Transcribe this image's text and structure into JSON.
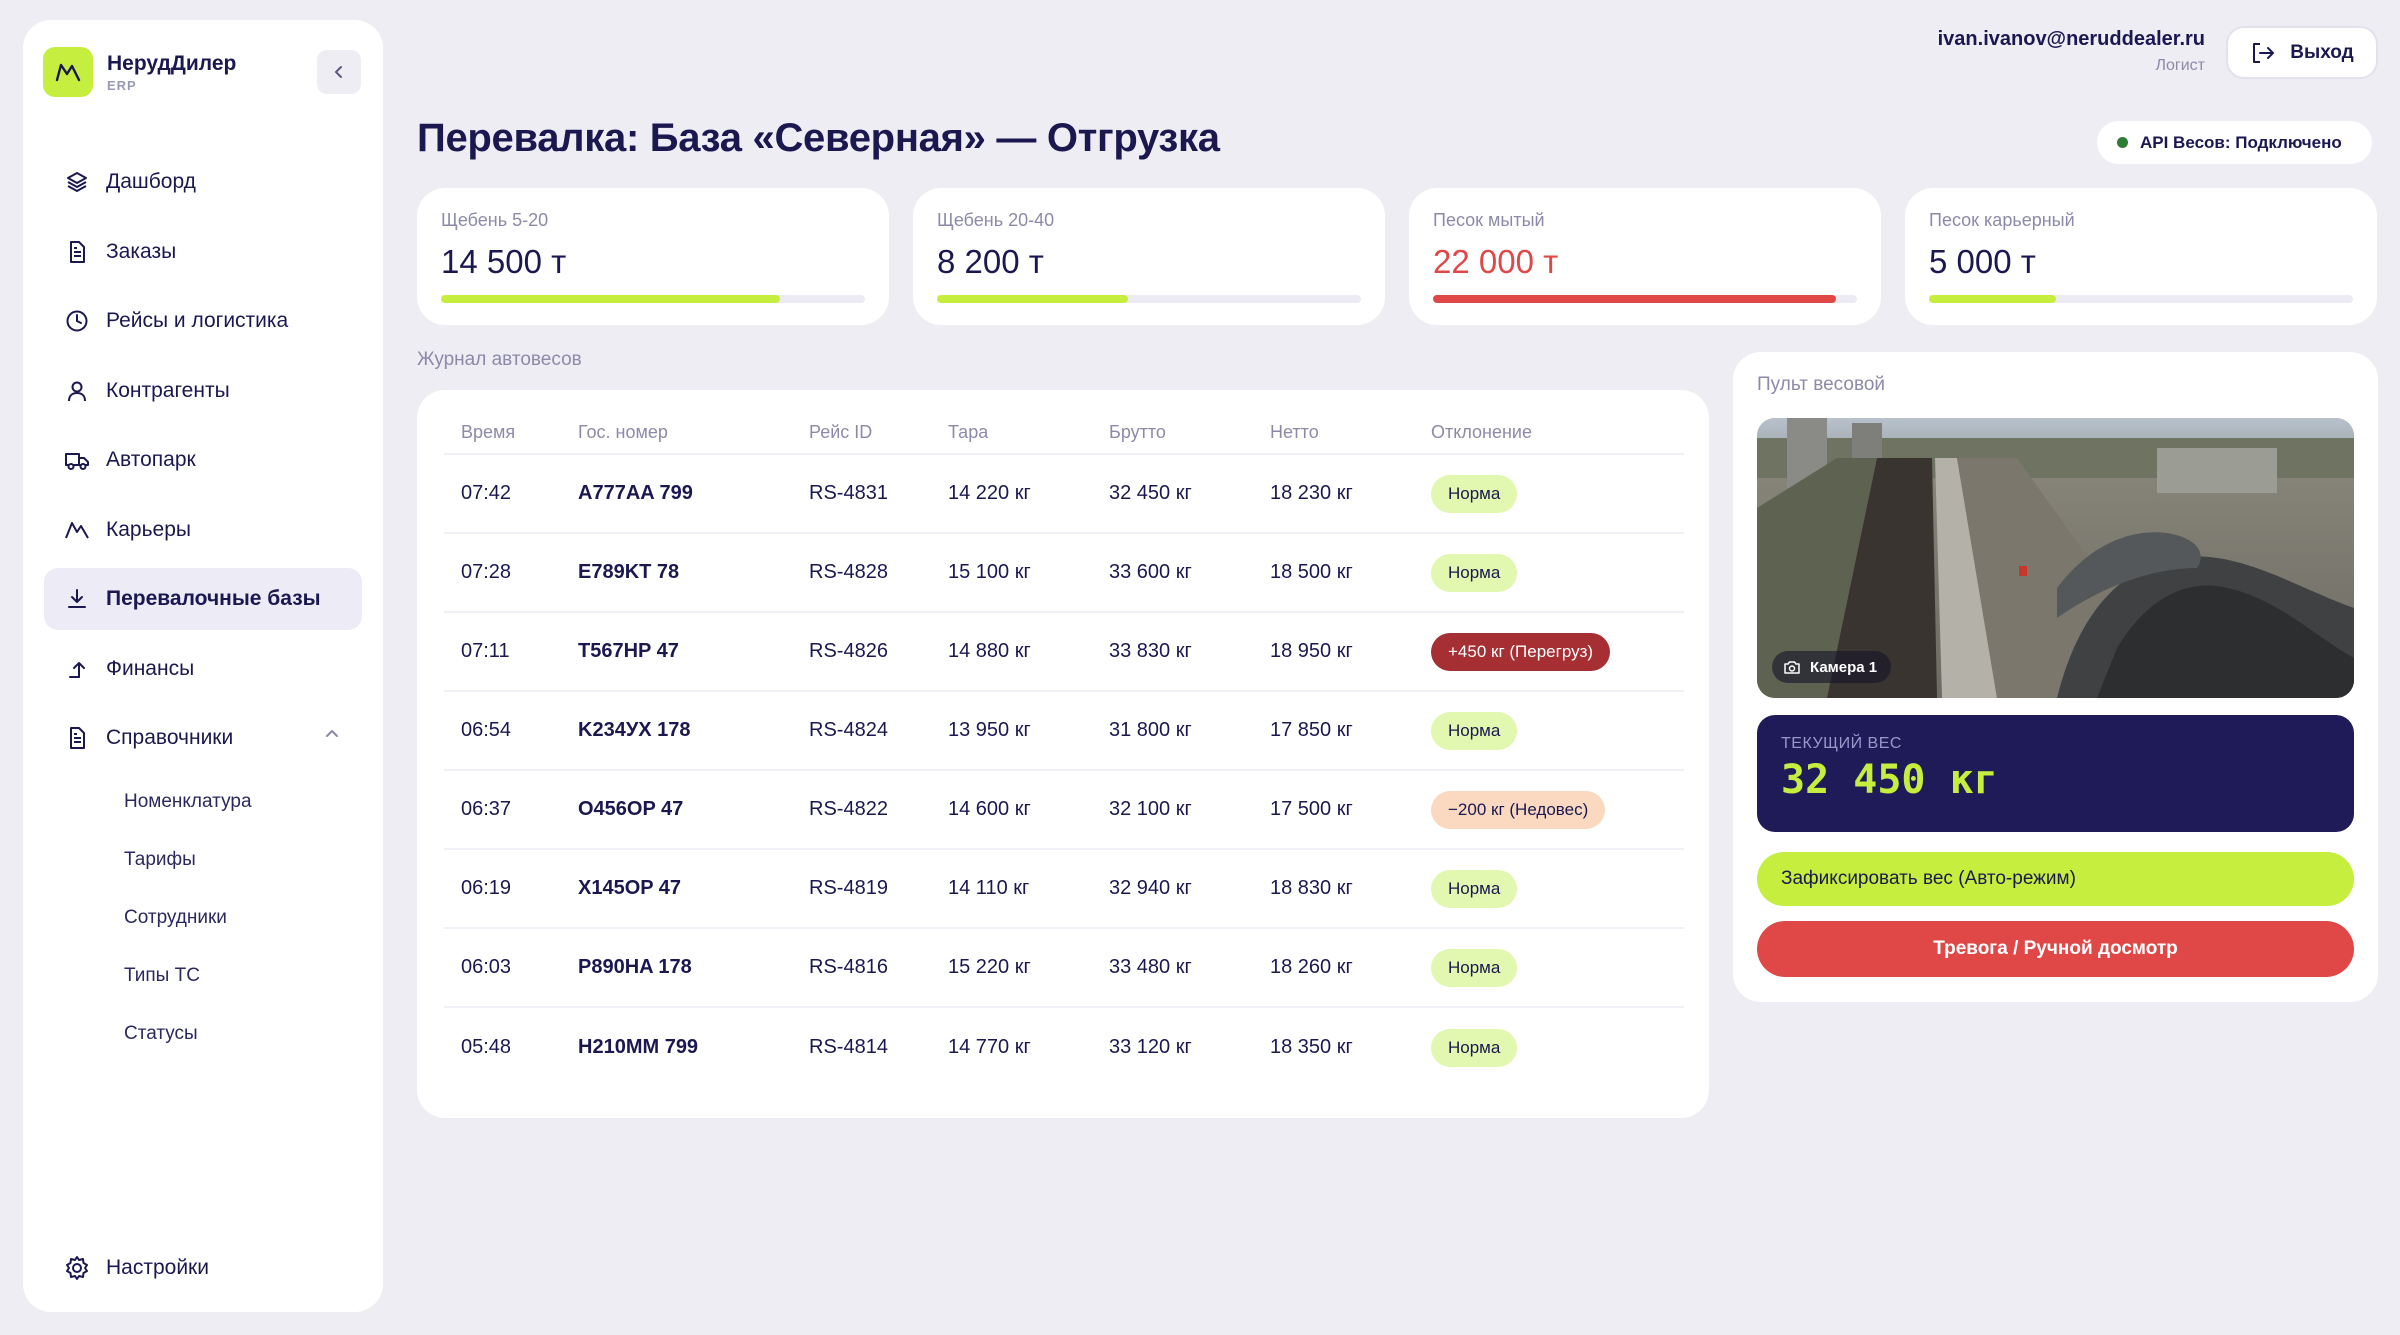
{
  "brand": {
    "name": "НерудДилер",
    "sub": "ERP"
  },
  "nav": {
    "items": [
      {
        "label": "Дашборд",
        "icon": "layers-icon"
      },
      {
        "label": "Заказы",
        "icon": "document-icon"
      },
      {
        "label": "Рейсы и логистика",
        "icon": "clock-icon"
      },
      {
        "label": "Контрагенты",
        "icon": "user-icon"
      },
      {
        "label": "Автопарк",
        "icon": "truck-icon"
      },
      {
        "label": "Карьеры",
        "icon": "mountain-icon"
      },
      {
        "label": "Перевалочные базы",
        "icon": "download-icon",
        "active": true
      },
      {
        "label": "Финансы",
        "icon": "arrow-up-icon"
      },
      {
        "label": "Справочники",
        "icon": "document-icon",
        "expanded": true
      }
    ],
    "sub_items": [
      "Номенклатура",
      "Тарифы",
      "Сотрудники",
      "Типы ТС",
      "Статусы"
    ],
    "settings": "Настройки"
  },
  "header": {
    "email": "ivan.ivanov@neruddealer.ru",
    "role": "Логист",
    "logout": "Выход"
  },
  "page": {
    "title": "Перевалка: База «Северная» — Отгрузка",
    "api_status": "API Весов: Подключено",
    "api_status_color": "#2e7d32"
  },
  "stocks": [
    {
      "label": "Щебень 5-20",
      "value": "14 500 т",
      "fill": 0.8,
      "alert": false
    },
    {
      "label": "Щебень 20-40",
      "value": "8 200 т",
      "fill": 0.45,
      "alert": false
    },
    {
      "label": "Песок мытый",
      "value": "22 000 т",
      "fill": 0.95,
      "alert": true
    },
    {
      "label": "Песок карьерный",
      "value": "5 000 т",
      "fill": 0.3,
      "alert": false
    }
  ],
  "log": {
    "title": "Журнал автовесов",
    "columns": [
      "Время",
      "Гос. номер",
      "Рейс ID",
      "Тара",
      "Брутто",
      "Нетто",
      "Отклонение"
    ],
    "rows": [
      {
        "time": "07:42",
        "plate": "A777AA 799",
        "trip": "RS-4831",
        "tare": "14 220 кг",
        "gross": "32 450 кг",
        "net": "18 230 кг",
        "deviation": "Норма",
        "status": "ok"
      },
      {
        "time": "07:28",
        "plate": "E789KT 78",
        "trip": "RS-4828",
        "tare": "15 100 кг",
        "gross": "33 600 кг",
        "net": "18 500 кг",
        "deviation": "Норма",
        "status": "ok"
      },
      {
        "time": "07:11",
        "plate": "T567HP 47",
        "trip": "RS-4826",
        "tare": "14 880 кг",
        "gross": "33 830 кг",
        "net": "18 950 кг",
        "deviation": "+450 кг (Перегруз)",
        "status": "over"
      },
      {
        "time": "06:54",
        "plate": "K234УX 178",
        "trip": "RS-4824",
        "tare": "13 950 кг",
        "gross": "31 800 кг",
        "net": "17 850 кг",
        "deviation": "Норма",
        "status": "ok"
      },
      {
        "time": "06:37",
        "plate": "O456OP 47",
        "trip": "RS-4822",
        "tare": "14 600 кг",
        "gross": "32 100 кг",
        "net": "17 500 кг",
        "deviation": "−200 кг (Недовес)",
        "status": "under"
      },
      {
        "time": "06:19",
        "plate": "X145OP 47",
        "trip": "RS-4819",
        "tare": "14 110 кг",
        "gross": "32 940 кг",
        "net": "18 830 кг",
        "deviation": "Норма",
        "status": "ok"
      },
      {
        "time": "06:03",
        "plate": "P890HA 178",
        "trip": "RS-4816",
        "tare": "15 220 кг",
        "gross": "33 480 кг",
        "net": "18 260 кг",
        "deviation": "Норма",
        "status": "ok"
      },
      {
        "time": "05:48",
        "plate": "H210MM 799",
        "trip": "RS-4814",
        "tare": "14 770 кг",
        "gross": "33 120 кг",
        "net": "18 350 кг",
        "deviation": "Норма",
        "status": "ok"
      }
    ]
  },
  "scale": {
    "title": "Пульт весовой",
    "camera_label": "Камера 1",
    "weight_label": "ТЕКУЩИЙ ВЕС",
    "weight_value": "32 450 кг",
    "fix_button": "Зафиксировать вес (Авто-режим)",
    "alarm_button": "Тревога / Ручной досмотр"
  },
  "colors": {
    "accent": "#c5ee3f",
    "navy": "#1e1b58",
    "danger": "#e04848",
    "background": "#eeedf4"
  }
}
